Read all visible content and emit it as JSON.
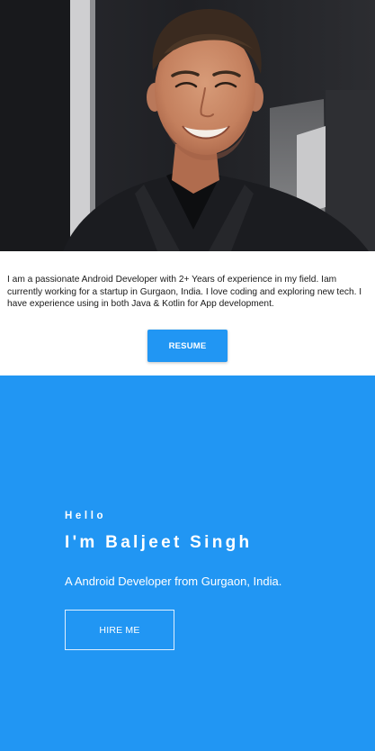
{
  "profile": {
    "photo_alt": "Profile photo"
  },
  "about": {
    "text": "I am a passionate Android Developer with 2+ Years of experience in my field. Iam currently working for a startup in Gurgaon, India. I love coding and exploring new tech. I have experience using in both Java & Kotlin for App development.",
    "resume_label": "RESUME"
  },
  "intro": {
    "greeting": "Hello",
    "name": "I'm Baljeet Singh",
    "tagline": "A Android Developer from Gurgaon, India.",
    "hire_label": "HIRE ME"
  },
  "colors": {
    "accent": "#2196f3",
    "text": "#1a1a1a",
    "on_accent": "#ffffff"
  }
}
